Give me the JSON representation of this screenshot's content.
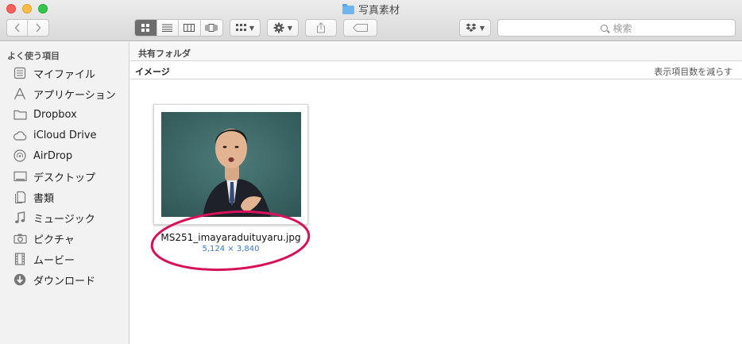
{
  "window": {
    "title": "写真素材"
  },
  "toolbar": {
    "search_placeholder": "検索"
  },
  "sidebar": {
    "heading": "よく使う項目",
    "items": [
      {
        "label": "マイファイル",
        "icon": "all-files-icon"
      },
      {
        "label": "アプリケーション",
        "icon": "applications-icon"
      },
      {
        "label": "Dropbox",
        "icon": "folder-icon"
      },
      {
        "label": "iCloud Drive",
        "icon": "cloud-icon"
      },
      {
        "label": "AirDrop",
        "icon": "airdrop-icon"
      },
      {
        "label": "デスクトップ",
        "icon": "desktop-icon"
      },
      {
        "label": "書類",
        "icon": "documents-icon"
      },
      {
        "label": "ミュージック",
        "icon": "music-note-icon"
      },
      {
        "label": "ピクチャ",
        "icon": "camera-icon"
      },
      {
        "label": "ムービー",
        "icon": "film-icon"
      },
      {
        "label": "ダウンロード",
        "icon": "download-icon"
      }
    ]
  },
  "main": {
    "path_label": "共有フォルダ",
    "group_title": "イメージ",
    "show_fewer_label": "表示項目数を減らす",
    "file": {
      "name": "MS251_imayaraduituyaru.jpg",
      "dimensions": "5,124 × 3,840"
    }
  },
  "colors": {
    "accent_link": "#3a78c8",
    "highlight_ring": "#d6135a",
    "photo_background": "#3f6b6b"
  }
}
